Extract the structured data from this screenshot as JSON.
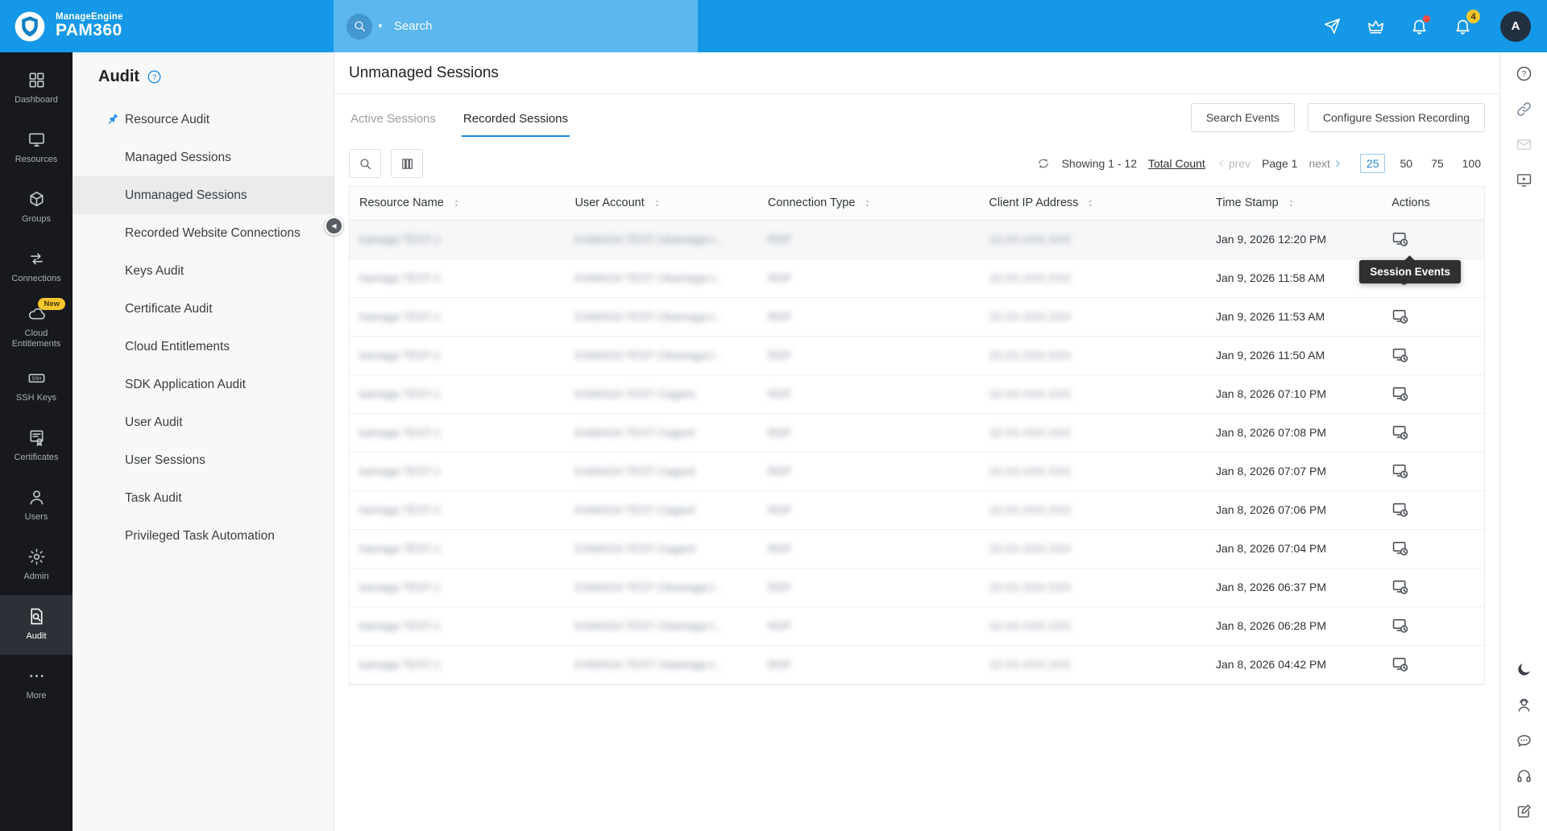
{
  "brand": {
    "company": "ManageEngine",
    "product": "PAM360"
  },
  "topbar": {
    "search_placeholder": "Search",
    "notification_count": "4",
    "avatar_letter": "A",
    "icons": [
      "send-icon",
      "crown-icon",
      "alert-bell-icon",
      "notification-bell-icon"
    ]
  },
  "nav": {
    "items": [
      {
        "id": "dashboard",
        "label": "Dashboard",
        "icon": "dashboard-icon",
        "active": false
      },
      {
        "id": "resources",
        "label": "Resources",
        "icon": "resources-icon",
        "active": false
      },
      {
        "id": "groups",
        "label": "Groups",
        "icon": "groups-icon",
        "active": false
      },
      {
        "id": "connections",
        "label": "Connections",
        "icon": "connections-icon",
        "active": false
      },
      {
        "id": "cloud-entitlements",
        "label": "Cloud Entitlements",
        "icon": "cloud-icon",
        "badge": "New",
        "active": false
      },
      {
        "id": "ssh-keys",
        "label": "SSH Keys",
        "icon": "ssh-icon",
        "active": false
      },
      {
        "id": "certificates",
        "label": "Certificates",
        "icon": "certificates-icon",
        "active": false
      },
      {
        "id": "users",
        "label": "Users",
        "icon": "users-icon",
        "active": false
      },
      {
        "id": "admin",
        "label": "Admin",
        "icon": "admin-icon",
        "active": false
      },
      {
        "id": "audit",
        "label": "Audit",
        "icon": "audit-icon",
        "active": true
      },
      {
        "id": "more",
        "label": "More",
        "icon": "more-icon",
        "active": false
      }
    ]
  },
  "sidebar": {
    "title": "Audit",
    "items": [
      {
        "label": "Resource Audit",
        "pinned": true,
        "active": false
      },
      {
        "label": "Managed Sessions",
        "active": false
      },
      {
        "label": "Unmanaged Sessions",
        "active": true
      },
      {
        "label": "Recorded Website Connections",
        "active": false
      },
      {
        "label": "Keys Audit",
        "active": false
      },
      {
        "label": "Certificate Audit",
        "active": false
      },
      {
        "label": "Cloud Entitlements",
        "active": false
      },
      {
        "label": "SDK Application Audit",
        "active": false
      },
      {
        "label": "User Audit",
        "active": false
      },
      {
        "label": "User Sessions",
        "active": false
      },
      {
        "label": "Task Audit",
        "active": false
      },
      {
        "label": "Privileged Task Automation",
        "active": false
      }
    ]
  },
  "main": {
    "title": "Unmanaged Sessions",
    "tabs": [
      {
        "label": "Active Sessions",
        "active": false
      },
      {
        "label": "Recorded Sessions",
        "active": true
      }
    ],
    "actions": {
      "search_events": "Search Events",
      "configure_recording": "Configure Session Recording"
    },
    "pagination": {
      "showing": "Showing 1 - 12",
      "total_count": "Total Count",
      "prev": "prev",
      "page": "Page 1",
      "next": "next",
      "page_sizes": [
        "25",
        "50",
        "75",
        "100"
      ],
      "selected_page_size": "25"
    },
    "tooltip": "Session Events",
    "table": {
      "redacted_columns": [
        "resource",
        "user_account",
        "connection_type",
        "client_ip"
      ],
      "columns": [
        {
          "label": "Resource Name",
          "sortable": true
        },
        {
          "label": "User Account",
          "sortable": true
        },
        {
          "label": "Connection Type",
          "sortable": true
        },
        {
          "label": "Client IP Address",
          "sortable": true
        },
        {
          "label": "Time Stamp",
          "sortable": true
        },
        {
          "label": "Actions",
          "sortable": false
        }
      ],
      "rows": [
        {
          "resource": "kamaga TEST-1",
          "user_account": "KAMAGA TEST-1\\kamaga-t...",
          "connection_type": "RDP",
          "client_ip": "10.XX.XXX.XXX",
          "time_stamp": "Jan 9, 2026 12:20 PM"
        },
        {
          "resource": "kamaga TEST-1",
          "user_account": "KAMAGA TEST-1\\kamaga-t...",
          "connection_type": "RDP",
          "client_ip": "10.XX.XXX.XXX",
          "time_stamp": "Jan 9, 2026 11:58 AM"
        },
        {
          "resource": "kamaga TEST-1",
          "user_account": "KAMAGA TEST-1\\kamaga-t...",
          "connection_type": "RDP",
          "client_ip": "10.XX.XXX.XXX",
          "time_stamp": "Jan 9, 2026 11:53 AM"
        },
        {
          "resource": "kamaga TEST-1",
          "user_account": "KAMAGA TEST-1\\kamaga-t...",
          "connection_type": "RDP",
          "client_ip": "10.XX.XXX.XXX",
          "time_stamp": "Jan 9, 2026 11:50 AM"
        },
        {
          "resource": "kamaga TEST-1",
          "user_account": "KAMAGA TEST-1\\agent",
          "connection_type": "RDP",
          "client_ip": "10.XX.XXX.XXX",
          "time_stamp": "Jan 8, 2026 07:10 PM"
        },
        {
          "resource": "kamaga TEST-1",
          "user_account": "KAMAGA TEST-1\\agent",
          "connection_type": "RDP",
          "client_ip": "10.XX.XXX.XXX",
          "time_stamp": "Jan 8, 2026 07:08 PM"
        },
        {
          "resource": "kamaga TEST-1",
          "user_account": "KAMAGA TEST-1\\agent",
          "connection_type": "RDP",
          "client_ip": "10.XX.XXX.XXX",
          "time_stamp": "Jan 8, 2026 07:07 PM"
        },
        {
          "resource": "kamaga TEST-1",
          "user_account": "KAMAGA TEST-1\\agent",
          "connection_type": "RDP",
          "client_ip": "10.XX.XXX.XXX",
          "time_stamp": "Jan 8, 2026 07:06 PM"
        },
        {
          "resource": "kamaga TEST-1",
          "user_account": "KAMAGA TEST-1\\agent",
          "connection_type": "RDP",
          "client_ip": "10.XX.XXX.XXX",
          "time_stamp": "Jan 8, 2026 07:04 PM"
        },
        {
          "resource": "kamaga TEST-1",
          "user_account": "KAMAGA TEST-1\\kamaga-t...",
          "connection_type": "RDP",
          "client_ip": "10.XX.XXX.XXX",
          "time_stamp": "Jan 8, 2026 06:37 PM"
        },
        {
          "resource": "kamaga TEST-1",
          "user_account": "KAMAGA TEST-1\\kamaga-t...",
          "connection_type": "RDP",
          "client_ip": "10.XX.XXX.XXX",
          "time_stamp": "Jan 8, 2026 06:28 PM"
        },
        {
          "resource": "kamaga TEST-1",
          "user_account": "KAMAGA TEST-1\\kamaga-t...",
          "connection_type": "RDP",
          "client_ip": "10.XX.XXX.XXX",
          "time_stamp": "Jan 8, 2026 04:42 PM"
        }
      ]
    }
  },
  "right_rail": {
    "top": [
      "help-icon",
      "link-icon",
      "mail-icon",
      "session-rail-icon"
    ],
    "bottom": [
      "moon-icon",
      "support-icon",
      "chat-icon",
      "headset-icon",
      "feedback-icon"
    ]
  },
  "colors": {
    "topbar_blue": "#1598e7",
    "accent_blue": "#1d86dd",
    "badge_yellow": "#f6c62d",
    "alert_red": "#ff4a45",
    "dark_nav": "#17191e"
  }
}
